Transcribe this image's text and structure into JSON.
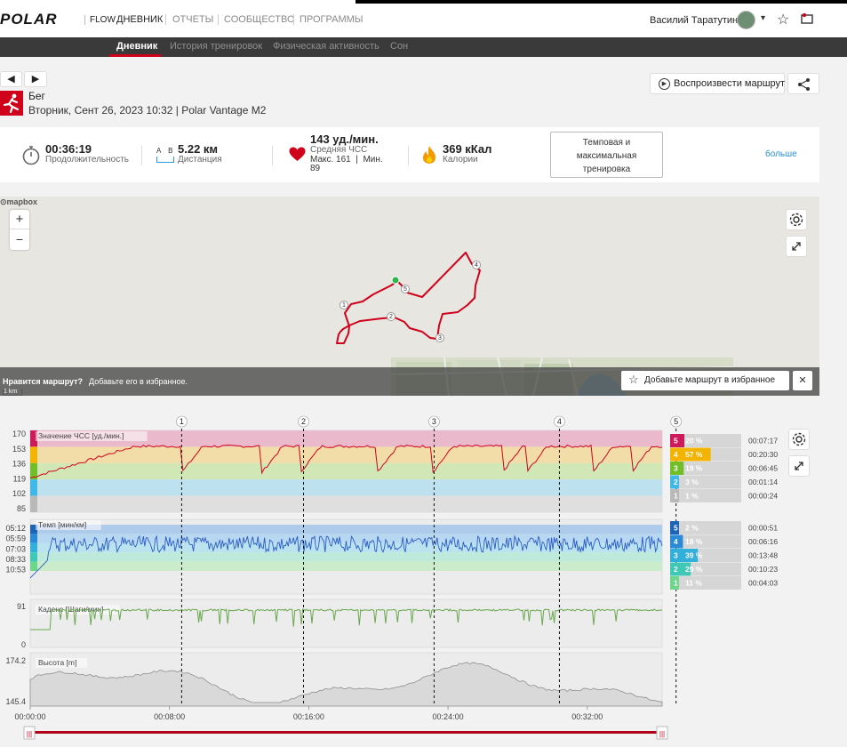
{
  "header": {
    "logo": "POLAR",
    "flow": "FLOW",
    "nav": [
      "ДНЕВНИК",
      "ОТЧЕТЫ",
      "СООБЩЕСТВО",
      "ПРОГРАММЫ"
    ],
    "user_name": "Василий Таратутин",
    "user_caret": "▾"
  },
  "subnav": [
    "Дневник",
    "История тренировок",
    "Физическая активность",
    "Сон"
  ],
  "activity": {
    "sport": "Бег",
    "datetime": "Вторник, Сент 26, 2023 10:32 | Polar Vantage M2",
    "replay_button": "Воспроизвести маршрут"
  },
  "summary": {
    "duration_value": "00:36:19",
    "duration_label": "Продолжительность",
    "distance_ab": "A B",
    "distance_value": "5.22 км",
    "distance_label": "Дистанция",
    "hr_value": "143 уд./мин.",
    "hr_avg_label": "Средняя ЧСС",
    "hr_maxmin_1": "Макс. 161  |  Мин.",
    "hr_maxmin_2": "89",
    "cal_value": "369 кКал",
    "cal_label": "Калории",
    "training_button": "Темповая и максимальная тренировка",
    "more": "больше"
  },
  "map": {
    "attribution": "mapbox",
    "zoom_in": "+",
    "zoom_out": "−",
    "scale": "1 km",
    "like_q": "Нравится маршрут?",
    "like_sub": "Добавьте его в избранное.",
    "fav_button": "Добавьте маршрут в избранное",
    "close": "✕",
    "markers": [
      "1",
      "2",
      "3",
      "4",
      "5"
    ]
  },
  "chart_data": {
    "type": "line",
    "x_label_ticks": [
      "00:00:00",
      "00:08:00",
      "00:16:00",
      "00:24:00",
      "00:32:00"
    ],
    "lap_markers": [
      "1",
      "2",
      "3",
      "4",
      "5"
    ],
    "lap_times_min": [
      8.7,
      15.7,
      23.2,
      30.4,
      37.1
    ],
    "x_range_min": [
      0,
      36.3
    ],
    "panels": [
      {
        "name": "Значение ЧСС [уд./мин.]",
        "y_ticks": [
          "170",
          "153",
          "136",
          "119",
          "102",
          "85"
        ],
        "ylim": [
          85,
          170
        ],
        "zones": [
          {
            "zone": "5",
            "percent": "20 %",
            "time": "00:07:17",
            "color": "#cc1b5a"
          },
          {
            "zone": "4",
            "percent": "57 %",
            "time": "00:20:30",
            "color": "#f2b400"
          },
          {
            "zone": "3",
            "percent": "19 %",
            "time": "00:06:45",
            "color": "#71bd2a"
          },
          {
            "zone": "2",
            "percent": "3 %",
            "time": "00:01:14",
            "color": "#3fb8e5"
          },
          {
            "zone": "1",
            "percent": "1 %",
            "time": "00:00:24",
            "color": "#b9b9b9"
          }
        ]
      },
      {
        "name": "Темп [мин/км]",
        "y_ticks": [
          "05:12",
          "05:59",
          "07:03",
          "08:33",
          "10:53"
        ],
        "zones": [
          {
            "zone": "5",
            "percent": "2 %",
            "time": "00:00:51",
            "color": "#1e63b6"
          },
          {
            "zone": "4",
            "percent": "18 %",
            "time": "00:06:16",
            "color": "#2b8ad6"
          },
          {
            "zone": "3",
            "percent": "39 %",
            "time": "00:13:48",
            "color": "#33b0d9"
          },
          {
            "zone": "2",
            "percent": "29 %",
            "time": "00:10:23",
            "color": "#3fc8b6"
          },
          {
            "zone": "1",
            "percent": "11 %",
            "time": "00:04:03",
            "color": "#6ed68c"
          }
        ]
      },
      {
        "name": "Каденс [Шаги/мин]",
        "y_ticks": [
          "91",
          "0"
        ],
        "ylim": [
          0,
          91
        ]
      },
      {
        "name": "Высота [m]",
        "y_ticks": [
          "174.2",
          "145.4"
        ],
        "ylim": [
          145.4,
          174.2
        ]
      }
    ]
  }
}
